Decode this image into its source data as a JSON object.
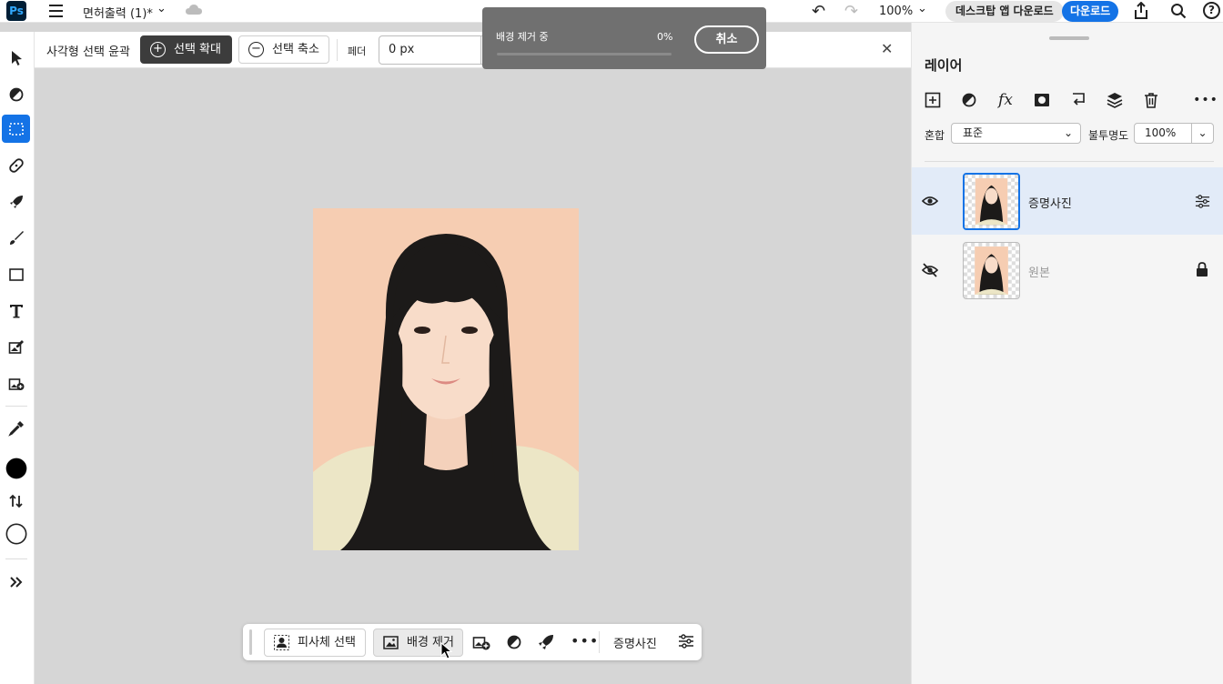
{
  "app": {
    "logo": "Ps",
    "doc_title": "면허출력 (1)*",
    "zoom": "100%"
  },
  "topbar": {
    "desktop_button": "데스크탑 앱 다운로드",
    "download_button": "다운로드",
    "help": "?"
  },
  "options": {
    "label": "사각형 선택 윤곽",
    "expand_button": "선택 확대",
    "contract_button": "선택 축소",
    "feather_label": "페더",
    "feather_value": "0 px"
  },
  "toast": {
    "title": "배경 제거 중",
    "percent": "0%",
    "progress": 0,
    "cancel": "취소"
  },
  "contextbar": {
    "select_subject": "피사체 선택",
    "remove_background": "배경 제거",
    "more": "•••",
    "layer_name": "증명사진"
  },
  "layers_panel": {
    "title": "레이어",
    "blend_label": "혼합",
    "blend_value": "표준",
    "opacity_label": "불투명도",
    "opacity_value": "100%",
    "layers": [
      {
        "name": "증명사진",
        "visible": true,
        "selected": true,
        "locked": false
      },
      {
        "name": "원본",
        "visible": false,
        "selected": false,
        "locked": true
      }
    ]
  },
  "colors": {
    "accent": "#1473e6",
    "toast_bg": "#707070",
    "canvas_bg": "#d6d6d6",
    "photo_bg": "#f6cdb2"
  }
}
